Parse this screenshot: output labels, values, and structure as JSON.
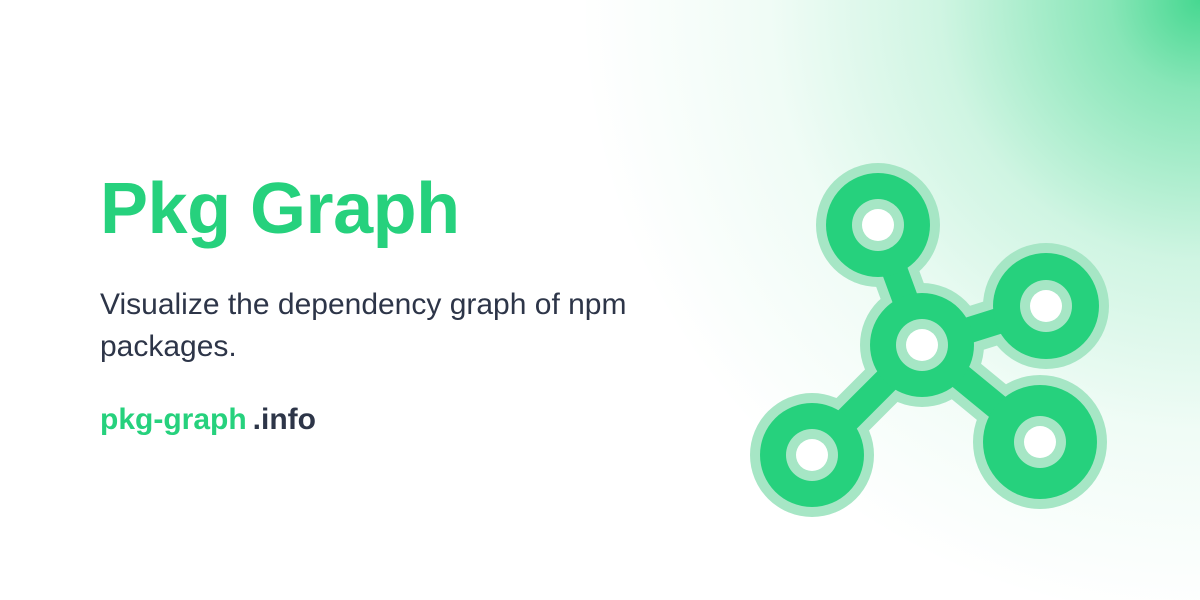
{
  "brand": {
    "title": "Pkg Graph",
    "tagline": "Visualize the dependency graph of npm packages.",
    "domain_name": "pkg-graph",
    "domain_tld": ".info"
  },
  "logo": {
    "icon": "dependency-graph-icon"
  },
  "colors": {
    "accent": "#26D17D",
    "accent_light": "#A6E6C5",
    "text_dark": "#2D3548",
    "background": "#FFFFFF"
  }
}
